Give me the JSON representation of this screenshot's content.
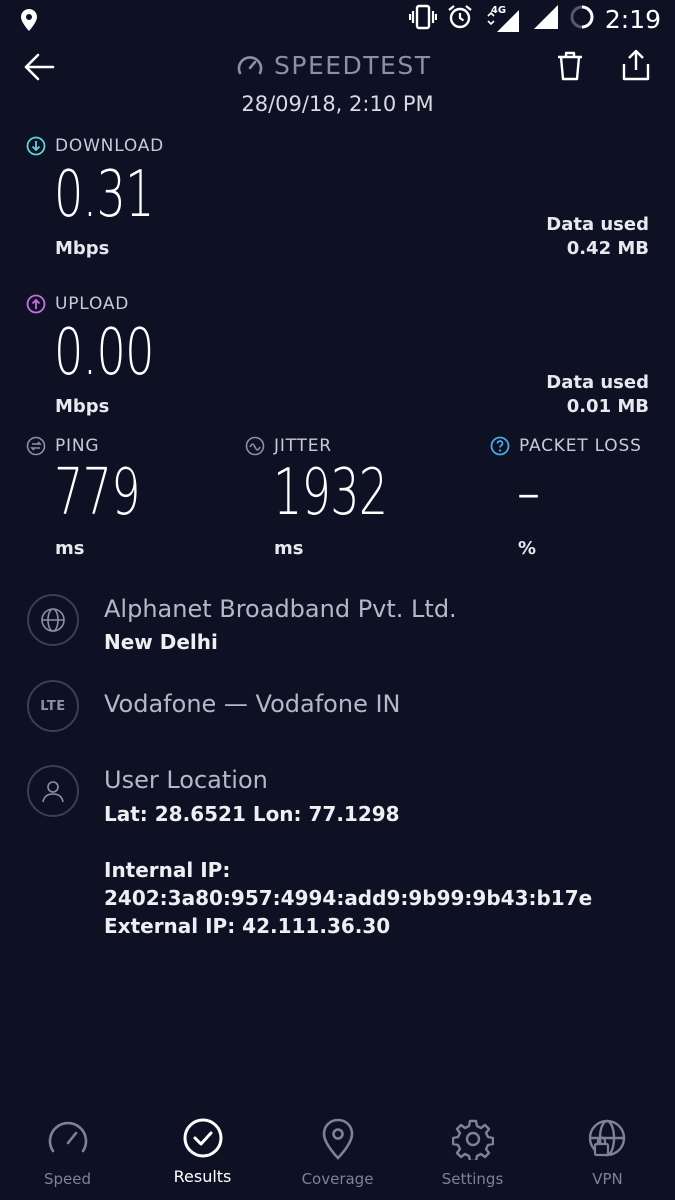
{
  "status_bar": {
    "network": "4G",
    "time": "2:19"
  },
  "header": {
    "title": "SPEEDTEST",
    "date": "28/09/18, 2:10 PM"
  },
  "download": {
    "label": "DOWNLOAD",
    "value": "0.31",
    "unit": "Mbps",
    "data_used_label": "Data used",
    "data_used_value": "0.42 MB",
    "color": "#5ed4d8"
  },
  "upload": {
    "label": "UPLOAD",
    "value": "0.00",
    "unit": "Mbps",
    "data_used_label": "Data used",
    "data_used_value": "0.01 MB",
    "color": "#c86ee0"
  },
  "ping": {
    "label": "PING",
    "value": "779",
    "unit": "ms"
  },
  "jitter": {
    "label": "JITTER",
    "value": "1932",
    "unit": "ms"
  },
  "packet_loss": {
    "label": "PACKET LOSS",
    "value": "–",
    "unit": "%",
    "color": "#4fa8e8"
  },
  "isp": {
    "name": "Alphanet Broadband Pvt. Ltd.",
    "city": "New Delhi"
  },
  "carrier": {
    "badge": "LTE",
    "name": "Vodafone — Vodafone IN"
  },
  "location": {
    "title": "User Location",
    "coords": "Lat: 28.6521 Lon: 77.1298",
    "internal_ip_label": "Internal IP:",
    "internal_ip": "2402:3a80:957:4994:add9:9b99:9b43:b17e",
    "external_ip": "External IP: 42.111.36.30"
  },
  "nav": [
    {
      "label": "Speed",
      "icon": "speedometer-icon"
    },
    {
      "label": "Results",
      "icon": "check-circle-icon",
      "active": true
    },
    {
      "label": "Coverage",
      "icon": "map-pin-icon"
    },
    {
      "label": "Settings",
      "icon": "gear-icon"
    },
    {
      "label": "VPN",
      "icon": "globe-lock-icon"
    }
  ]
}
